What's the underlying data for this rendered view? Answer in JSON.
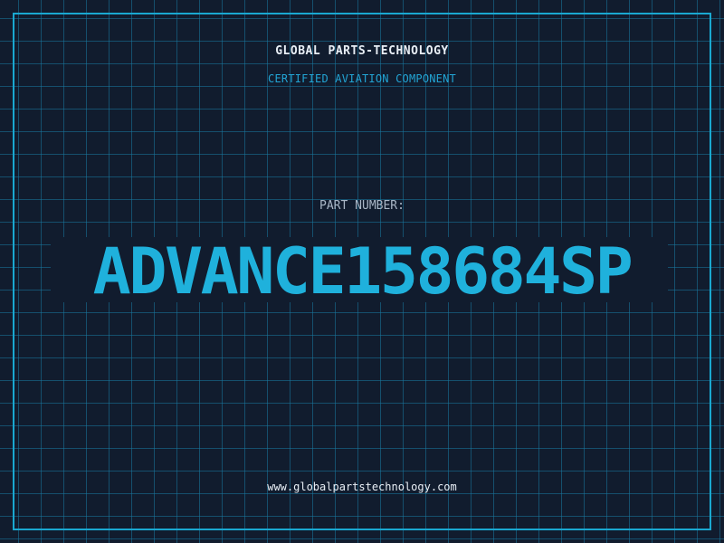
{
  "header": {
    "company": "GLOBAL PARTS-TECHNOLOGY",
    "subtitle": "CERTIFIED AVIATION COMPONENT"
  },
  "part": {
    "label": "PART NUMBER:",
    "number": "ADVANCE158684SP"
  },
  "footer": {
    "website": "www.globalpartstechnology.com"
  },
  "colors": {
    "background": "#111c2e",
    "grid": "#1878a0",
    "accent": "#1fb1dc",
    "text": "#e8eef5"
  }
}
